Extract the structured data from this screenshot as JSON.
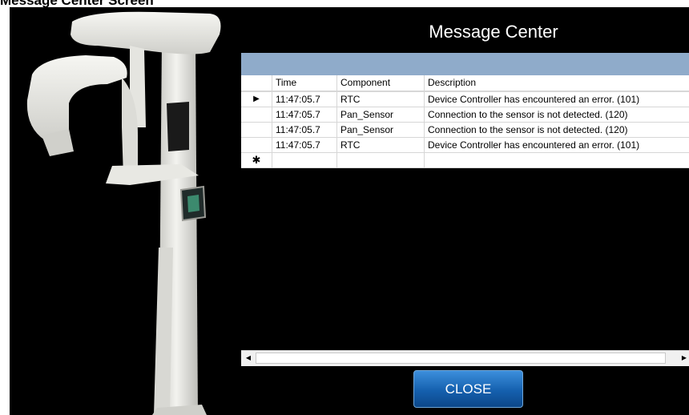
{
  "page_heading": "Message Center Screen",
  "window": {
    "title": "Message Center"
  },
  "grid": {
    "columns": [
      {
        "key": "time",
        "label": "Time"
      },
      {
        "key": "component",
        "label": "Component"
      },
      {
        "key": "description",
        "label": "Description"
      }
    ],
    "current_row_marker": "▶",
    "new_row_marker": "✱",
    "rows": [
      {
        "time": "11:47:05.7",
        "component": "RTC",
        "description": "Device Controller has encountered an error. (101)"
      },
      {
        "time": "11:47:05.7",
        "component": "Pan_Sensor",
        "description": "Connection to the sensor is not detected. (120)"
      },
      {
        "time": "11:47:05.7",
        "component": "Pan_Sensor",
        "description": "Connection to the sensor is not detected. (120)"
      },
      {
        "time": "11:47:05.7",
        "component": "RTC",
        "description": "Device Controller has encountered an error. (101)"
      }
    ]
  },
  "scrollbar": {
    "left_arrow": "◀",
    "right_arrow": "▶"
  },
  "buttons": {
    "close_label": "CLOSE"
  },
  "colors": {
    "header_bar": "#8fabca",
    "button_blue": "#1560ae",
    "screen_bg": "#000000"
  },
  "icons": {
    "device": "panoramic-xray-device-image"
  }
}
